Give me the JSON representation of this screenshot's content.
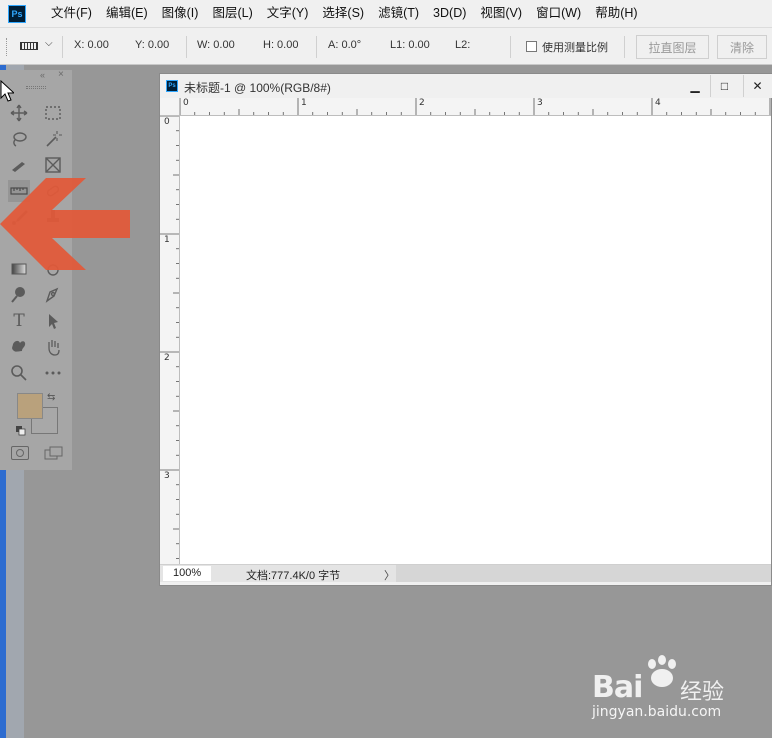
{
  "menubar": {
    "logo": "Ps",
    "items": [
      "文件(F)",
      "编辑(E)",
      "图像(I)",
      "图层(L)",
      "文字(Y)",
      "选择(S)",
      "滤镜(T)",
      "3D(D)",
      "视图(V)",
      "窗口(W)",
      "帮助(H)"
    ]
  },
  "options": {
    "x": "X: 0.00",
    "y": "Y: 0.00",
    "w": "W: 0.00",
    "h": "H: 0.00",
    "a": "A: 0.0°",
    "l1": "L1: 0.00",
    "l2": "L2:",
    "use_scale": "使用测量比例",
    "straighten": "拉直图层",
    "clear": "清除"
  },
  "toolpanel": {
    "collapse": "«",
    "close": "×",
    "type_tool_glyph": "T"
  },
  "document": {
    "ps_icon": "Ps",
    "title": "未标题-1 @ 100%(RGB/8#)",
    "minimize": "▁",
    "maximize": "□",
    "close": "✕",
    "ruler_h": [
      "0",
      "1",
      "2",
      "3",
      "4"
    ],
    "ruler_v": [
      "0",
      "1",
      "2",
      "3"
    ],
    "zoom": "100%",
    "doc_info": "文档:777.4K/0 字节",
    "status_arrow": "〉"
  },
  "colors": {
    "foreground": "#b9a17c",
    "background": "#a8a8a8",
    "arrow": "#e05a3a",
    "highlight_strip": "#2d6cd0"
  },
  "watermark": {
    "logo": "Bai",
    "logo_end": "经验",
    "url": "jingyan.baidu.com"
  }
}
